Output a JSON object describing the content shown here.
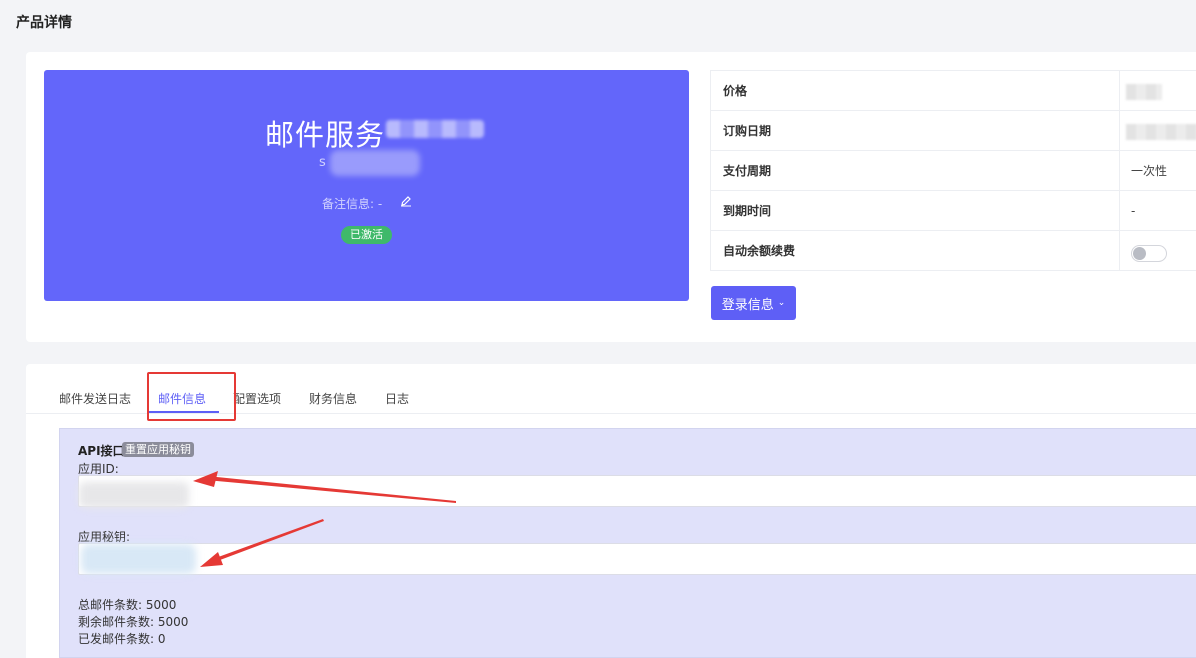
{
  "page": {
    "title": "产品详情"
  },
  "hero": {
    "name": "邮件服务",
    "sub": "s",
    "remark_label": "备注信息: -",
    "status_badge": "已激活"
  },
  "info": {
    "rows": [
      {
        "label": "价格",
        "value": ""
      },
      {
        "label": "订购日期",
        "value": ""
      },
      {
        "label": "支付周期",
        "value": "一次性"
      },
      {
        "label": "到期时间",
        "value": "-"
      },
      {
        "label": "自动余额续费",
        "value": ""
      }
    ],
    "auto_renew_on": false
  },
  "login_button": {
    "label": "登录信息"
  },
  "tabs": [
    {
      "label": "邮件发送日志",
      "active": false
    },
    {
      "label": "邮件信息",
      "active": true
    },
    {
      "label": "配置选项",
      "active": false
    },
    {
      "label": "财务信息",
      "active": false
    },
    {
      "label": "日志",
      "active": false
    }
  ],
  "api": {
    "title": "API接口",
    "reset_label": "重置应用秘钥",
    "app_id_label": "应用ID:",
    "app_secret_label": "应用秘钥:",
    "stats": [
      "总邮件条数: 5000",
      "剩余邮件条数: 5000",
      "已发邮件条数: 0"
    ]
  },
  "colors": {
    "accent": "#5e5ff6",
    "hero_bg": "#6366fa",
    "badge_green": "#3fb96a",
    "annotation_red": "#e53935",
    "panel_bg": "#e0e1fa"
  }
}
